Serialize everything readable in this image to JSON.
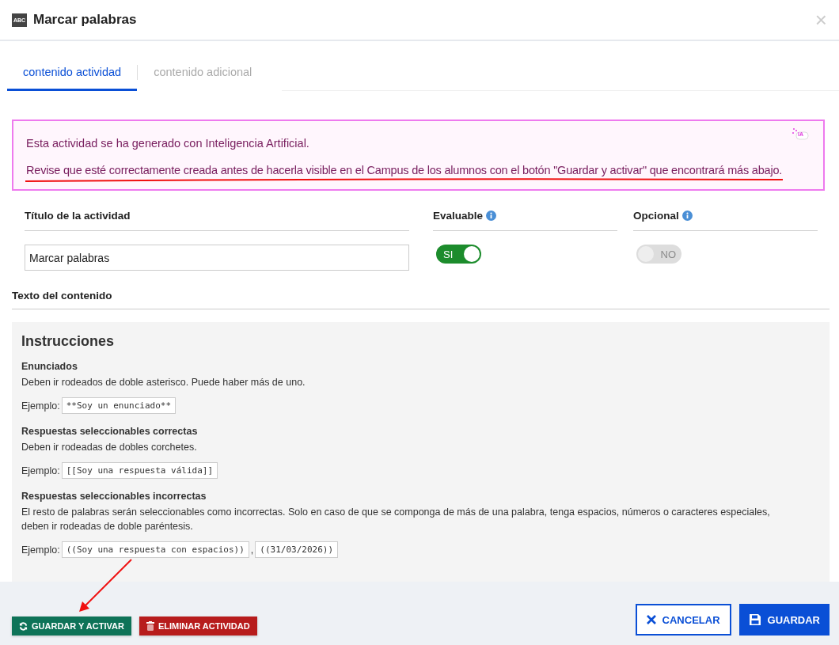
{
  "window": {
    "title": "Marcar palabras",
    "icon_text": "ABC",
    "close": "×"
  },
  "tabs": [
    {
      "label": "contenido actividad",
      "selected": true
    },
    {
      "label": "contenido adicional",
      "selected": false
    }
  ],
  "notice": {
    "lines": [
      "Esta actividad se ha generado con Inteligencia Artificial.",
      "Revise que esté correctamente creada antes de hacerla visible en el Campus de los alumnos con el botón \"Guardar y activar\" que encontrará más abajo."
    ],
    "badge": "IA"
  },
  "fields": {
    "title": {
      "label": "Título de la actividad",
      "value": "Marcar palabras"
    },
    "evaluable": {
      "label": "Evaluable",
      "on": true,
      "text": "SI"
    },
    "optional": {
      "label": "Opcional",
      "on": false,
      "text": "NO"
    }
  },
  "content_label": "Texto del contenido",
  "instructions": {
    "heading": "Instrucciones",
    "sections": [
      {
        "title": "Enunciados",
        "description": "Deben ir rodeados de doble asterisco. Puede haber más de uno.",
        "example_label": "Ejemplo:",
        "examples": [
          "**Soy un enunciado**"
        ]
      },
      {
        "title": "Respuestas seleccionables correctas",
        "description": "Deben ir rodeadas de dobles corchetes.",
        "example_label": "Ejemplo:",
        "examples": [
          "[[Soy una respuesta válida]]"
        ]
      },
      {
        "title": "Respuestas seleccionables incorrectas",
        "description": "El resto de palabras serán seleccionables como incorrectas. Solo en caso de que se componga de más de una palabra, tenga espacios, números o caracteres especiales, deben ir rodeadas de doble paréntesis.",
        "example_label": "Ejemplo:",
        "examples": [
          "((Soy una respuesta con espacios))",
          "((31/03/2026))"
        ],
        "separator": ","
      }
    ]
  },
  "footer": {
    "buttons": [
      {
        "label": "GUARDAR Y ACTIVAR",
        "kind": "activate"
      },
      {
        "label": "ELIMINAR ACTIVIDAD",
        "kind": "delete"
      },
      {
        "label": "CANCELAR",
        "kind": "cancel"
      },
      {
        "label": "GUARDAR",
        "kind": "save"
      }
    ]
  }
}
